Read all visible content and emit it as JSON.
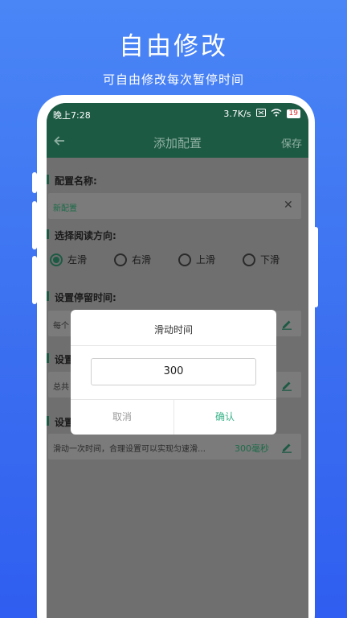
{
  "promo": {
    "title": "自由修改",
    "subtitle": "可自由修改每次暂停时间"
  },
  "status_bar": {
    "time": "晚上7:28",
    "network_speed": "3.7K/s",
    "battery": "19"
  },
  "app_bar": {
    "title": "添加配置",
    "save_label": "保存"
  },
  "config_name": {
    "label": "配置名称:",
    "value": "新配置"
  },
  "direction": {
    "label": "选择阅读方向:",
    "options": [
      "左滑",
      "右滑",
      "上滑",
      "下滑"
    ],
    "selected": "左滑"
  },
  "dwell_time": {
    "label": "设置停留时间:",
    "description": "每个"
  },
  "second_setting": {
    "label": "设置",
    "description": "总共"
  },
  "third_setting": {
    "label": "设置",
    "description": "滑动一次时间，合理设置可以实现匀速滑…",
    "value": "300毫秒"
  },
  "dialog": {
    "title": "滑动时间",
    "input_value": "300",
    "cancel_label": "取消",
    "confirm_label": "确认"
  },
  "colors": {
    "background": "#3b6ff0",
    "app_primary": "#1d5a44",
    "confirm": "#39b38a"
  }
}
